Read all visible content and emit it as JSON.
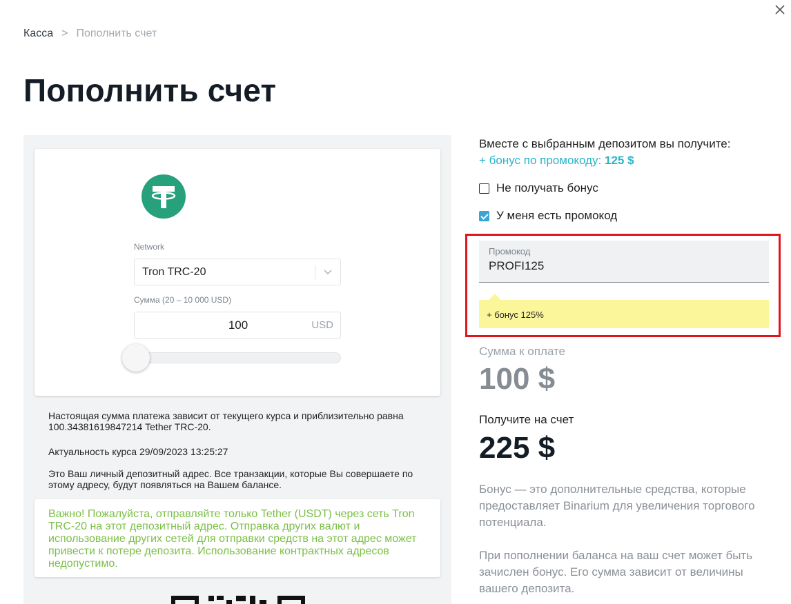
{
  "breadcrumb": {
    "root": "Касса",
    "separator": ">",
    "current": "Пополнить счет"
  },
  "page_title": "Пополнить счет",
  "deposit_form": {
    "coin_icon": "tether-icon",
    "network_label": "Network",
    "network_value": "Tron TRC-20",
    "amount_label": "Сумма (20 – 10 000 USD)",
    "amount_value": "100",
    "amount_currency": "USD",
    "amount_min": 20,
    "amount_max": 10000,
    "slider_value": 100
  },
  "info": {
    "rate_text": "Настоящая сумма платежа зависит от текущего курса и приблизительно равна 100.34381619847214 Tether TRC-20.",
    "rate_date": "Актуальность курса 29/09/2023 13:25:27",
    "address_text": "Это Ваш личный депозитный адрес. Все транзакции, которые Вы совершаете по этому адресу, будут появляться на Вашем балансе."
  },
  "warning": {
    "text": "Важно! Пожалуйста, отправляйте только Tether (USDT) через сеть Tron TRC-20 на этот депозитный адрес. Отправка других валют и использование других сетей для отправки средств на этот адрес может привести к потере депозита. Использование контрактных адресов недопустимо."
  },
  "bonus": {
    "intro": "Вместе с выбранным депозитом вы получите:",
    "promo_prefix": "+ бонус по промокоду:",
    "promo_value": "125 $",
    "no_bonus_label": "Не получать бонус",
    "no_bonus_checked": false,
    "have_promo_label": "У меня есть промокод",
    "have_promo_checked": true,
    "promo_field_label": "Промокод",
    "promo_field_value": "PROFI125",
    "promo_tip": "+ бонус 125%"
  },
  "summary": {
    "pay_label": "Сумма к оплате",
    "pay_amount": "100 $",
    "get_label": "Получите на счет",
    "get_amount": "225 $",
    "desc_1": "Бонус — это дополнительные средства, которые предоставляет Binarium для увеличения торгового потенциала.",
    "desc_2": "При пополнении баланса на ваш счет может быть зачислен бонус. Его сумма зависит от величины вашего депозита."
  },
  "colors": {
    "accent": "#2bb3c9",
    "tether_green": "#26a17b",
    "warning_green": "#7cbf47",
    "highlight_red": "#e0141c",
    "tip_yellow": "#fcf69b",
    "checkbox_blue": "#3aa6d6"
  }
}
